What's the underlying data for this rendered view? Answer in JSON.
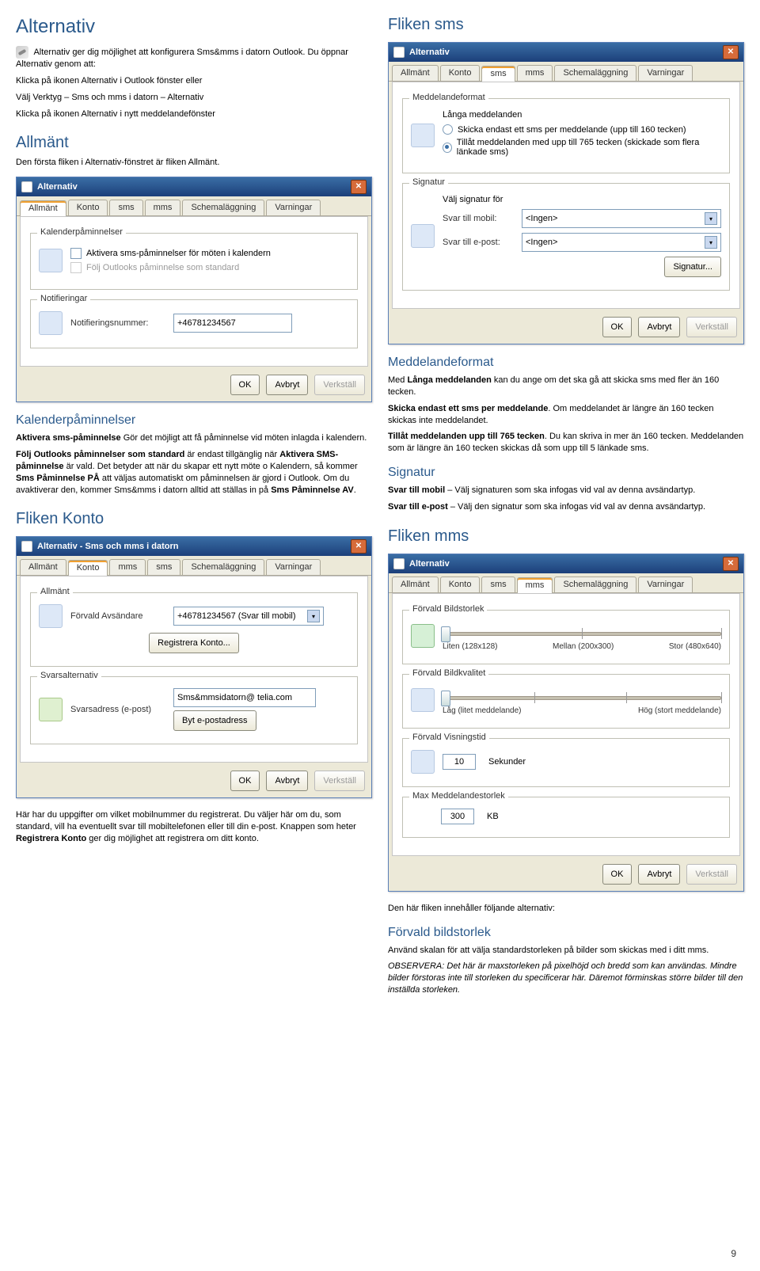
{
  "left": {
    "h1": "Alternativ",
    "intro": " Alternativ ger dig möjlighet att konfigurera Sms&mms i datorn Outlook. Du öppnar Alternativ genom att:",
    "intro2": "Klicka på ikonen Alternativ i Outlook fönster eller",
    "intro3": "Välj Verktyg – Sms och mms i datorn – Alternativ",
    "intro4": "Klicka på ikonen Alternativ i nytt meddelandefönster",
    "h_allmant": "Allmänt",
    "p_allmant": "Den första fliken i Alternativ-fönstret är fliken Allmänt.",
    "dlg1": {
      "title": "Alternativ",
      "tabs": [
        "Allmänt",
        "Konto",
        "sms",
        "mms",
        "Schemaläggning",
        "Varningar"
      ],
      "grp1": "Kalenderpåminnelser",
      "cb1": "Aktivera sms-påminnelser för möten i kalendern",
      "cb2": "Följ Outlooks påminnelse som standard",
      "grp2": "Notifieringar",
      "notlbl": "Notifieringsnummer:",
      "notval": "+46781234567",
      "ok": "OK",
      "cancel": "Avbryt",
      "apply": "Verkställ"
    },
    "h_kalender": "Kalenderpåminnelser",
    "p_kal1a": "Aktivera sms-påminnelse",
    "p_kal1b": " Gör det möjligt att få påminnelse vid möten inlagda i kalendern.",
    "p_kal2a": "Följ Outlooks påminnelser som standard",
    "p_kal2b": " är endast tillgänglig när ",
    "p_kal2c": "Aktivera SMS-påminnelse",
    "p_kal2d": " är vald. Det betyder att när du skapar ett nytt möte o Kalendern, så kommer ",
    "p_kal2e": "Sms Påminnelse PÅ",
    "p_kal2f": " att väljas automatiskt om påminnelsen är gjord i Outlook. Om du avaktiverar den, kommer Sms&mms i datorn alltid att ställas in på ",
    "p_kal2g": "Sms Påminnelse AV",
    "p_kal2h": ".",
    "h_konto": "Fliken Konto",
    "dlg2": {
      "title": "Alternativ - Sms och mms i datorn",
      "tabs": [
        "Allmänt",
        "Konto",
        "mms",
        "sms",
        "Schemaläggning",
        "Varningar"
      ],
      "grp1": "Allmänt",
      "avs_lbl": "Förvald Avsändare",
      "avs_val": "+46781234567 (Svar till mobil)",
      "reg_btn": "Registrera Konto...",
      "grp2": "Svarsalternativ",
      "svars_lbl": "Svarsadress (e-post)",
      "svars_val": "Sms&mmsidatorn@ telia.com",
      "byt_btn": "Byt e-postadress",
      "ok": "OK",
      "cancel": "Avbryt",
      "apply": "Verkställ"
    },
    "p_konto1": "Här har du uppgifter om vilket mobilnummer du registrerat. Du väljer här om du, som standard, vill ha eventuellt svar till mobiltelefonen eller till din e-post. Knappen som heter ",
    "p_konto1b": "Registrera Konto",
    "p_konto1c": " ger dig möjlighet att registrera om ditt konto."
  },
  "right": {
    "h_sms": "Fliken sms",
    "dlg3": {
      "title": "Alternativ",
      "tabs": [
        "Allmänt",
        "Konto",
        "sms",
        "mms",
        "Schemaläggning",
        "Varningar"
      ],
      "grp1": "Meddelandeformat",
      "r1": "Långa meddelanden",
      "r2": "Skicka endast ett sms per meddelande (upp till 160 tecken)",
      "r3": "Tillåt meddelanden med upp till 765 tecken (skickade som flera länkade sms)",
      "grp2": "Signatur",
      "sig_lbl": "Välj signatur för",
      "sig_mobil_lbl": "Svar till mobil:",
      "sig_mobil_val": "<Ingen>",
      "sig_epost_lbl": "Svar till e-post:",
      "sig_epost_val": "<Ingen>",
      "sig_btn": "Signatur...",
      "ok": "OK",
      "cancel": "Avbryt",
      "apply": "Verkställ"
    },
    "h_medformat": "Meddelandeformat",
    "p_mf1a": "Med ",
    "p_mf1b": "Långa meddelanden",
    "p_mf1c": " kan du ange om det ska gå att skicka sms med fler än 160 tecken.",
    "p_mf2a": "Skicka endast ett sms per meddelande",
    "p_mf2b": ". Om meddelandet är längre än 160 tecken skickas inte meddelandet.",
    "p_mf3a": "Tillåt meddelanden upp till 765 tecken",
    "p_mf3b": ". Du kan skriva in mer än 160 tecken. Meddelanden som är längre än 160 tecken skickas då som upp till 5 länkade sms.",
    "h_signatur": "Signatur",
    "p_sig1a": "Svar till mobil",
    "p_sig1b": " – Välj signaturen som ska infogas vid val av denna avsändartyp.",
    "p_sig2a": "Svar till e-post",
    "p_sig2b": " – Välj den signatur som ska infogas vid val av denna avsändartyp.",
    "h_mms": "Fliken mms",
    "dlg4": {
      "title": "Alternativ",
      "tabs": [
        "Allmänt",
        "Konto",
        "sms",
        "mms",
        "Schemaläggning",
        "Varningar"
      ],
      "grp1": "Förvald Bildstorlek",
      "size_a": "Liten (128x128)",
      "size_b": "Mellan (200x300)",
      "size_c": "Stor (480x640)",
      "grp2": "Förvald Bildkvalitet",
      "q_a": "Låg (litet meddelande)",
      "q_b": "Hög (stort meddelande)",
      "grp3": "Förvald Visningstid",
      "vis_val": "10",
      "vis_unit": "Sekunder",
      "grp4": "Max Meddelandestorlek",
      "max_val": "300",
      "max_unit": "KB",
      "ok": "OK",
      "cancel": "Avbryt",
      "apply": "Verkställ"
    },
    "p_mms1": "Den här fliken innehåller följande alternativ:",
    "h_forvald": "Förvald bildstorlek",
    "p_fb1": "Använd skalan för att välja standardstorleken på bilder som skickas med i ditt mms.",
    "p_fb2a": "OBSERVERA: Det här är maxstorleken på pixelhöjd och bredd som kan användas. Mindre bilder förstoras inte till storleken du specificerar här. Däremot förminskas större bilder till den inställda storleken."
  },
  "pagenum": "9"
}
